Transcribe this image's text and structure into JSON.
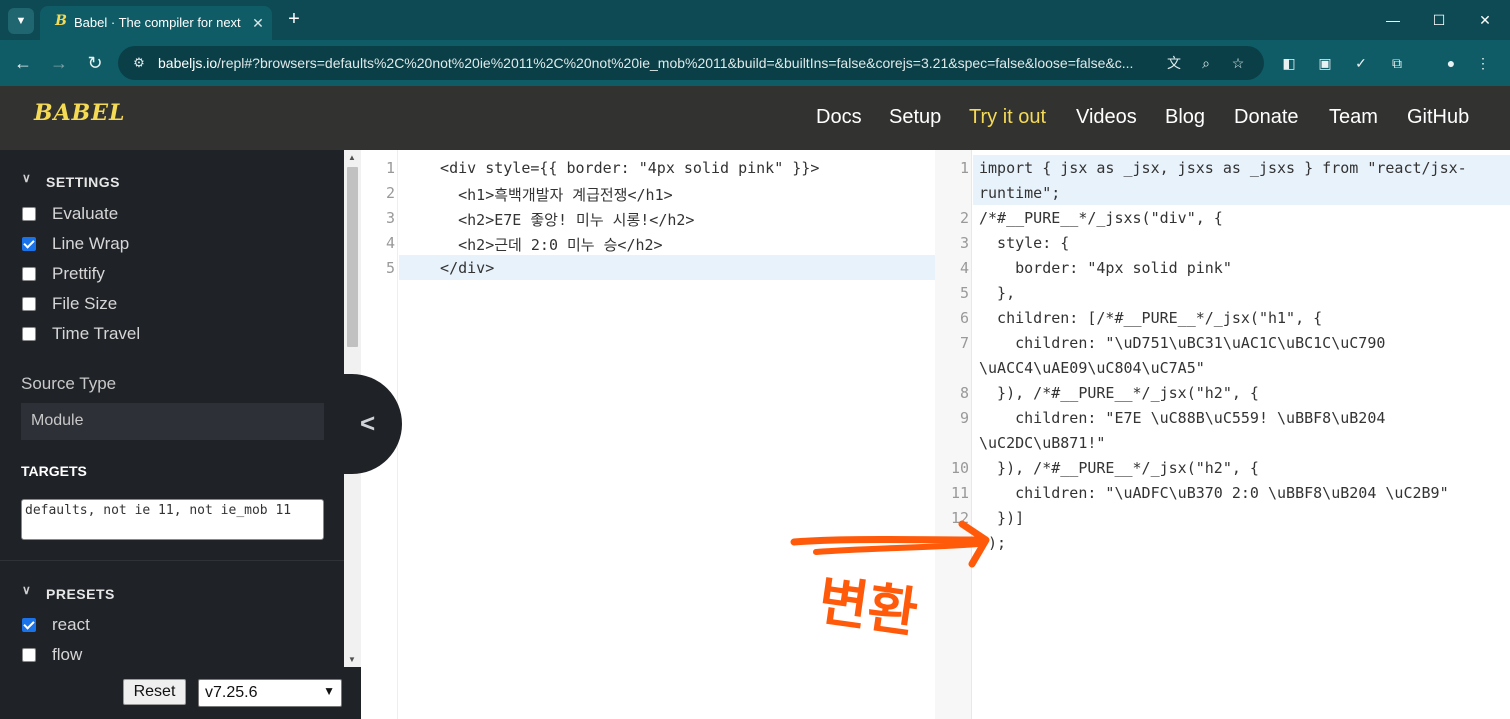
{
  "browser": {
    "tab_title": "Babel · The compiler for next generation JavaScript",
    "url_host": "babeljs.io",
    "url_rest": "/repl#?browsers=defaults%2C%20not%20ie%2011%2C%20not%20ie_mob%2011&build=&builtIns=false&corejs=3.21&spec=false&loose=false&c...",
    "icons": {
      "tab_list": "chevron-down-icon",
      "favicon": "babel-favicon",
      "new_tab": "plus-icon",
      "back": "arrow-left-icon",
      "forward": "arrow-right-icon",
      "reload": "reload-icon",
      "site_info": "tune-icon",
      "translate": "translate-icon",
      "zoom": "zoom-icon",
      "bookmark": "star-icon",
      "profile": "person-icon"
    },
    "favicon_glyph": "B",
    "tab_close_glyph": "✕",
    "new_tab_glyph": "+",
    "minimize_glyph": "—",
    "maximize_glyph": "☐",
    "close_glyph": "✕"
  },
  "site_nav": {
    "logo": "BABEL",
    "links": [
      "Docs",
      "Setup",
      "Try it out",
      "Videos",
      "Blog",
      "Donate",
      "Team",
      "GitHub"
    ],
    "active": "Try it out",
    "accent_color": "#f5da55"
  },
  "sidebar": {
    "settings_title": "SETTINGS",
    "settings": [
      {
        "label": "Evaluate",
        "checked": false
      },
      {
        "label": "Line Wrap",
        "checked": true
      },
      {
        "label": "Prettify",
        "checked": false
      },
      {
        "label": "File Size",
        "checked": false
      },
      {
        "label": "Time Travel",
        "checked": false
      }
    ],
    "source_type_label": "Source Type",
    "source_type_value": "Module",
    "targets_label": "TARGETS",
    "targets_value": "defaults, not ie 11, not ie_mob 11",
    "presets_title": "PRESETS",
    "presets": [
      {
        "label": "react",
        "checked": true
      },
      {
        "label": "flow",
        "checked": false
      }
    ],
    "reset_label": "Reset",
    "version_value": "v7.25.6"
  },
  "input_editor": {
    "line_numbers": [
      "1",
      "2",
      "3",
      "4",
      "5"
    ],
    "lines": [
      "  <div style={{ border: \"4px solid pink\" }}>",
      "    <h1>흑백개발자 계급전쟁</h1>",
      "    <h2>E7E 좋앙! 미누 시롱!</h2>",
      "    <h2>근데 2:0 미누 승</h2>",
      "  </div>"
    ]
  },
  "output_editor": {
    "line_numbers": [
      "1",
      "2",
      "3",
      "4",
      "5",
      "6",
      "7",
      "8",
      "9",
      "10",
      "11",
      "12"
    ],
    "lines": [
      "import { jsx as _jsx, jsxs as _jsxs } from \"react/jsx-",
      "runtime\";",
      "/*#__PURE__*/_jsxs(\"div\", {",
      "  style: {",
      "    border: \"4px solid pink\"",
      "  },",
      "  children: [/*#__PURE__*/_jsx(\"h1\", {",
      "    children: \"\\uD751\\uBC31\\uAC1C\\uBC1C\\uC790",
      "\\uACC4\\uAE09\\uC804\\uC7A5\"",
      "  }), /*#__PURE__*/_jsx(\"h2\", {",
      "    children: \"E7E \\uC88B\\uC559! \\uBBF8\\uB204",
      "\\uC2DC\\uB871!\"",
      "  }), /*#__PURE__*/_jsx(\"h2\", {",
      "    children: \"\\uADFC\\uB370 2:0 \\uBBF8\\uB204 \\uC2B9\"",
      "  })]",
      "});"
    ]
  },
  "annotation": {
    "text": "변환",
    "color": "#ff5a0a"
  }
}
